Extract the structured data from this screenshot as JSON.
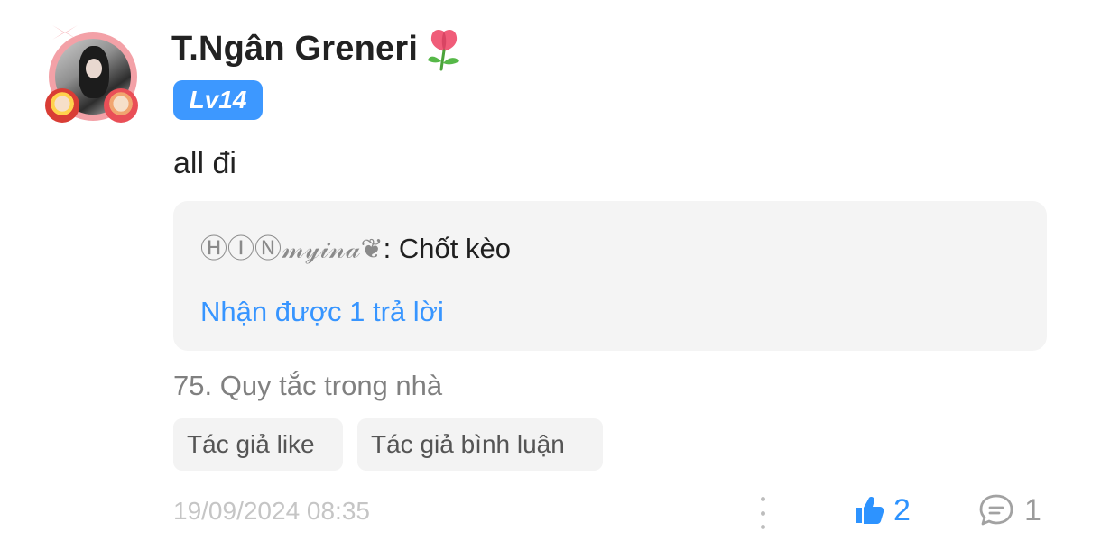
{
  "comment": {
    "username": "T.Ngân Greneri",
    "username_emoji": "tulip-icon",
    "level": "Lv14",
    "body": "all đi",
    "reply_preview": {
      "author": "ⒽⒾⓃ𝓂𝓎𝒾𝓃𝒶❦",
      "separator": ":",
      "message": "Chốt kèo",
      "reply_count_text": "Nhận được 1 trả lời"
    },
    "tag": "75. Quy tắc trong nhà",
    "chips": [
      {
        "label": "Tác giả like"
      },
      {
        "label": "Tác giả bình luận"
      }
    ],
    "timestamp": "19/09/2024 08:35",
    "actions": {
      "likes": "2",
      "comments": "1",
      "more_icon": "more-vertical-icon",
      "like_icon": "thumbs-up-icon",
      "comment_icon": "comment-bubble-icon"
    }
  },
  "colors": {
    "level_badge": "#3d98ff",
    "reply_link": "#3795ff",
    "like_active": "#2d93ff",
    "muted_text": "#808080",
    "timestamp": "#c5c5c5",
    "reply_box_bg": "#f4f4f4"
  }
}
